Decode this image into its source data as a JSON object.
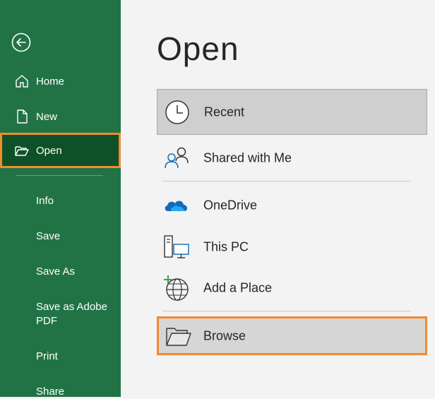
{
  "sidebar": {
    "back_icon": "back-arrow-circle-icon",
    "main_items": [
      {
        "label": "Home",
        "icon": "home-icon"
      },
      {
        "label": "New",
        "icon": "new-document-icon"
      },
      {
        "label": "Open",
        "icon": "open-folder-icon",
        "selected": true
      }
    ],
    "sub_items": [
      "Info",
      "Save",
      "Save As",
      "Save as Adobe PDF",
      "Print",
      "Share"
    ]
  },
  "main": {
    "title": "Open",
    "locations": [
      {
        "label": "Recent",
        "icon": "clock-icon",
        "selected": true
      },
      {
        "label": "Shared with Me",
        "icon": "shared-users-icon"
      },
      {
        "label": "OneDrive",
        "icon": "onedrive-cloud-icon"
      },
      {
        "label": "This PC",
        "icon": "pc-icon"
      },
      {
        "label": "Add a Place",
        "icon": "add-place-globe-icon"
      },
      {
        "label": "Browse",
        "icon": "browse-folder-icon",
        "highlighted": true
      }
    ]
  },
  "colors": {
    "sidebar_bg": "#217346",
    "selected_bg": "#0e5128",
    "highlight_border": "#f28a2e",
    "onedrive_blue": "#0f6cbd"
  }
}
